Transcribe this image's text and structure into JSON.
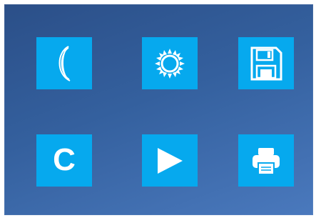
{
  "tiles": [
    {
      "icon": "moon-icon"
    },
    {
      "icon": "sun-icon"
    },
    {
      "icon": "floppy-disk-icon"
    },
    {
      "icon": "letter-c-icon",
      "label": "C"
    },
    {
      "icon": "play-icon"
    },
    {
      "icon": "printer-icon"
    }
  ],
  "colors": {
    "background_top": "#2b4f88",
    "background_bottom": "#4a79bd",
    "tile": "#06a9ee",
    "icon": "#ffffff"
  }
}
